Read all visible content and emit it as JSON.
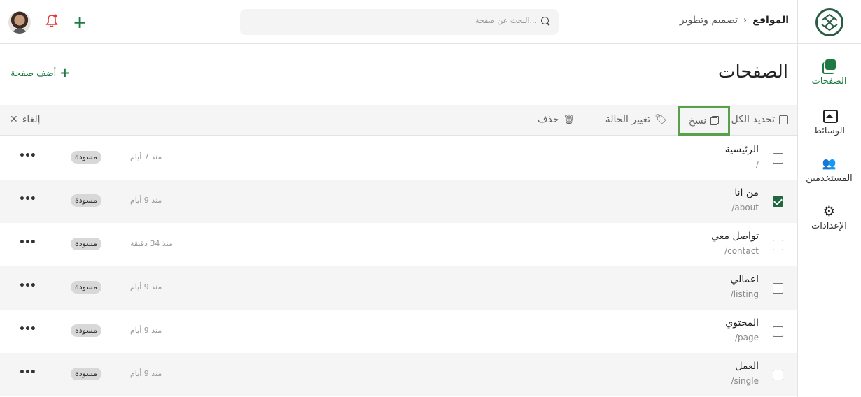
{
  "header": {
    "breadcrumb_root": "المواقع",
    "breadcrumb_sep": "›",
    "breadcrumb_current": "تصميم وتطوير",
    "search_placeholder": "البحث عن صفحة..."
  },
  "icons": {
    "logo": "globe-logo-icon",
    "search": "search-icon",
    "bell": "bell-notification-icon",
    "add": "plus-icon"
  },
  "nav": [
    {
      "label": "الصفحات",
      "icon": "pages-icon",
      "active": true
    },
    {
      "label": "الوسائط",
      "icon": "media-icon",
      "active": false
    },
    {
      "label": "المستخدمين",
      "icon": "users-icon",
      "active": false
    },
    {
      "label": "الإعدادات",
      "icon": "gear-icon",
      "active": false
    }
  ],
  "main": {
    "title": "الصفحات",
    "add_page_label": "أضف صفحة"
  },
  "toolbar": {
    "select_all": "تحديد الكل",
    "copy": "نسخ",
    "change_status": "تغيير الحالة",
    "delete": "حذف",
    "cancel": "إلغاء"
  },
  "rows": [
    {
      "title": "الرئيسية",
      "slug": "/",
      "date": "منذ 7 أيام",
      "status": "مسودة",
      "checked": false
    },
    {
      "title": "من انا",
      "slug": "/about",
      "date": "منذ 9 أيام",
      "status": "مسودة",
      "checked": true
    },
    {
      "title": "تواصل معي",
      "slug": "/contact",
      "date": "منذ 34 دقيقة",
      "status": "مسودة",
      "checked": false
    },
    {
      "title": "اعمالي",
      "slug": "/listing",
      "date": "منذ 9 أيام",
      "status": "مسودة",
      "checked": false
    },
    {
      "title": "المحتوي",
      "slug": "/page",
      "date": "منذ 9 أيام",
      "status": "مسودة",
      "checked": false
    },
    {
      "title": "العمل",
      "slug": "/single",
      "date": "منذ 9 أيام",
      "status": "مسودة",
      "checked": false
    }
  ],
  "colors": {
    "accent": "#1e7a42",
    "highlight_border": "#5aa04b",
    "notification": "#e53935"
  }
}
